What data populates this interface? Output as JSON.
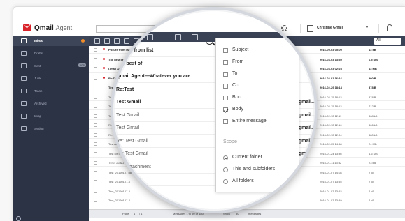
{
  "app": {
    "title": "Qmail",
    "subtitle": "Agent",
    "user": "Christine Gmail"
  },
  "sidebar": {
    "items": [
      {
        "label": "Inbox",
        "active": true
      },
      {
        "label": "Drafts",
        "active": false
      },
      {
        "label": "Sent",
        "count": "108",
        "active": false
      },
      {
        "label": "Junk",
        "active": false
      },
      {
        "label": "Trash",
        "active": false
      },
      {
        "label": "Archived",
        "active": false
      },
      {
        "label": "Imap",
        "active": false
      },
      {
        "label": "Syslog",
        "active": false
      }
    ]
  },
  "toolbar": {
    "filter_label": "All"
  },
  "mail_list": {
    "rows": [
      {
        "subject": "Picture from list",
        "date": "2016-09-03 05:00",
        "size": "13 kB",
        "unread": true,
        "flag": true
      },
      {
        "subject": "The best of",
        "date": "2016-03-03 13:30",
        "size": "6.5 MB",
        "unread": true,
        "flag": true
      },
      {
        "subject": "Qmail Agent",
        "date": "2016-03-03 02:23",
        "size": "13 MB",
        "unread": true,
        "flag": true
      },
      {
        "subject": "Re:Test",
        "date": "2016-03-01 16:16",
        "size": "900 B",
        "unread": true,
        "flag": true
      },
      {
        "subject": "Test Gmail",
        "date": "2016-02-29 18:14",
        "size": "378 B",
        "unread": true,
        "flag": false
      },
      {
        "subject": "Test Gmail",
        "date": "2016-02-15 18:12",
        "size": "378 B",
        "unread": false,
        "flag": false
      },
      {
        "subject": "Test Gmail",
        "date": "2016-02-15 18:12",
        "size": "712 B",
        "unread": false,
        "flag": false
      },
      {
        "subject": "Test Gmail",
        "date": "2016-02-12 12:11",
        "size": "368 kB",
        "unread": false,
        "flag": false
      },
      {
        "subject": "Re: Test Gmail",
        "date": "2016-02-12 12:10",
        "size": "366 kB",
        "unread": false,
        "flag": false
      },
      {
        "subject": "Re: Test Gmail",
        "date": "2016-02-12 12:04",
        "size": "380 kB",
        "unread": false,
        "flag": false
      },
      {
        "subject": "Test Attachment",
        "date": "2016-02-05 14:58",
        "size": "24 MB",
        "unread": false,
        "flag": false
      },
      {
        "subject": "Test MP3",
        "date": "2016-01-24 13:36",
        "size": "1.6 MB",
        "unread": false,
        "flag": false
      },
      {
        "subject": "TEST 2G&G",
        "date": "2016-01-11 13:52",
        "size": "23 kB",
        "unread": false,
        "flag": false
      },
      {
        "subject": "Test_20160107 g8",
        "date": "2016-01-07 14:08",
        "size": "2 kB",
        "unread": false,
        "flag": false
      },
      {
        "subject": "Test_20160107-6",
        "date": "2016-01-07 13:55",
        "size": "2 kB",
        "unread": false,
        "flag": false
      },
      {
        "subject": "Test_20160107-5",
        "date": "2016-01-07 13:52",
        "size": "2 kB",
        "unread": false,
        "flag": false
      },
      {
        "subject": "Test_20160107-4",
        "date": "2016-01-07 13:49",
        "size": "2 kB",
        "unread": false,
        "flag": false
      }
    ]
  },
  "magnified": {
    "rows": [
      {
        "subject": "Picture from list",
        "email": "",
        "date": "16-03 05:00",
        "unread": true,
        "flag": true
      },
      {
        "subject": "The best of",
        "email": "",
        "date": "16-03-03 13:30",
        "unread": true,
        "flag": true
      },
      {
        "subject": "Qmail Agent—Whatever you are",
        "email": "",
        "date": "6-03-03 02:23",
        "unread": true,
        "flag": true
      },
      {
        "subject": "Re:Test",
        "email": "",
        "date": "16-03-01 16:16",
        "unread": true,
        "flag": true
      },
      {
        "subject": "Test Gmail",
        "email": "@gmail...",
        "date": "2016-02-29 18:14",
        "unread": true,
        "flag": false
      },
      {
        "subject": "Test Gmail",
        "email": "@gmail...",
        "date": "2016-02-15 18:12",
        "unread": false,
        "flag": false
      },
      {
        "subject": "Test Gmail",
        "email": "@gmail...",
        "date": "2016-02-15 18:12",
        "unread": false,
        "flag": false
      },
      {
        "subject": "Re: Test Gmail",
        "email": "@gmail...",
        "date": "2016-02-12 12:11",
        "unread": false,
        "flag": false
      },
      {
        "subject": "Re: Test Gmail",
        "email": "@gmail...",
        "date": "2016-02-12 12:10",
        "unread": false,
        "flag": false
      },
      {
        "subject": "Test Attachment",
        "email": "@gmail...",
        "date": "2016-02-05 14:58",
        "unread": false,
        "flag": false
      },
      {
        "subject": "Test MP3",
        "email": "@gmail...",
        "date": "2016-01-24 13:36",
        "unread": false,
        "flag": false
      },
      {
        "subject": "TEST 2G&G",
        "email": "",
        "date": "2016-01-11 13:52",
        "unread": false,
        "flag": false
      },
      {
        "subject": "Test_20160107 g8",
        "email": "",
        "date": "2016-01-07 14:08",
        "unread": false,
        "flag": false
      },
      {
        "subject": "Test_20160107-6",
        "email": "",
        "date": "2016-01-07 13:55",
        "unread": false,
        "flag": false
      }
    ]
  },
  "search_dropdown": {
    "fields": [
      {
        "label": "Subject",
        "checked": false
      },
      {
        "label": "From",
        "checked": false
      },
      {
        "label": "To",
        "checked": false
      },
      {
        "label": "Cc",
        "checked": false
      },
      {
        "label": "Bcc",
        "checked": false
      },
      {
        "label": "Body",
        "checked": true
      },
      {
        "label": "Entire message",
        "checked": false
      }
    ],
    "scope_title": "Scope",
    "scopes": [
      {
        "label": "Current folder",
        "selected": true
      },
      {
        "label": "This and subfolders",
        "selected": false
      },
      {
        "label": "All folders",
        "selected": false
      }
    ]
  },
  "statusbar": {
    "page": "Page",
    "page_num": "1",
    "of": "/ 1",
    "messages": "Messages 1 to 50 of 180",
    "show": "Show",
    "per_page": "50",
    "per_label": "messages"
  },
  "colors": {
    "brand": "#d8232a",
    "sidebar_bg": "#2c3345",
    "toolbar_bg": "#3a4255",
    "accent_dot": "#f28c28"
  }
}
